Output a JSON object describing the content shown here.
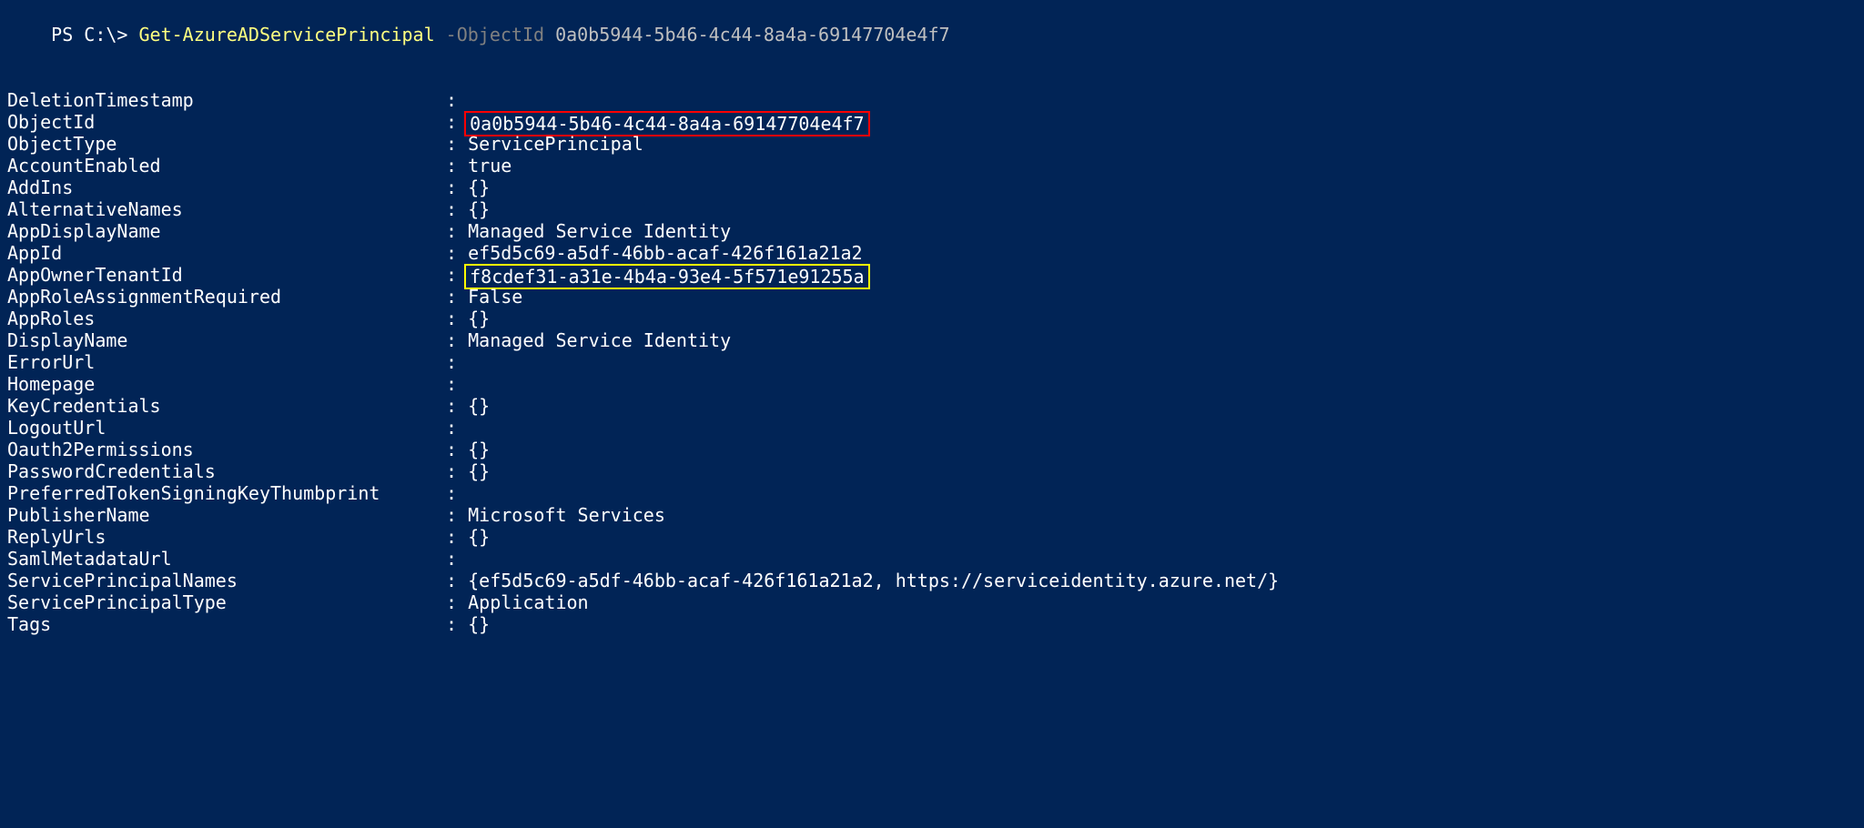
{
  "prompt": {
    "prefix": "PS C:\\> ",
    "cmdlet": "Get-AzureADServicePrincipal",
    "param": " -ObjectId ",
    "arg": "0a0b5944-5b46-4c44-8a4a-69147704e4f7"
  },
  "properties": [
    {
      "key": "DeletionTimestamp",
      "value": "",
      "highlight": null
    },
    {
      "key": "ObjectId",
      "value": "0a0b5944-5b46-4c44-8a4a-69147704e4f7",
      "highlight": "red"
    },
    {
      "key": "ObjectType",
      "value": "ServicePrincipal",
      "highlight": null
    },
    {
      "key": "AccountEnabled",
      "value": "true",
      "highlight": null
    },
    {
      "key": "AddIns",
      "value": "{}",
      "highlight": null
    },
    {
      "key": "AlternativeNames",
      "value": "{}",
      "highlight": null
    },
    {
      "key": "AppDisplayName",
      "value": "Managed Service Identity",
      "highlight": null
    },
    {
      "key": "AppId",
      "value": "ef5d5c69-a5df-46bb-acaf-426f161a21a2",
      "highlight": null
    },
    {
      "key": "AppOwnerTenantId",
      "value": "f8cdef31-a31e-4b4a-93e4-5f571e91255a",
      "highlight": "yellow"
    },
    {
      "key": "AppRoleAssignmentRequired",
      "value": "False",
      "highlight": null
    },
    {
      "key": "AppRoles",
      "value": "{}",
      "highlight": null
    },
    {
      "key": "DisplayName",
      "value": "Managed Service Identity",
      "highlight": null
    },
    {
      "key": "ErrorUrl",
      "value": "",
      "highlight": null
    },
    {
      "key": "Homepage",
      "value": "",
      "highlight": null
    },
    {
      "key": "KeyCredentials",
      "value": "{}",
      "highlight": null
    },
    {
      "key": "LogoutUrl",
      "value": "",
      "highlight": null
    },
    {
      "key": "Oauth2Permissions",
      "value": "{}",
      "highlight": null
    },
    {
      "key": "PasswordCredentials",
      "value": "{}",
      "highlight": null
    },
    {
      "key": "PreferredTokenSigningKeyThumbprint",
      "value": "",
      "highlight": null
    },
    {
      "key": "PublisherName",
      "value": "Microsoft Services",
      "highlight": null
    },
    {
      "key": "ReplyUrls",
      "value": "{}",
      "highlight": null
    },
    {
      "key": "SamlMetadataUrl",
      "value": "",
      "highlight": null
    },
    {
      "key": "ServicePrincipalNames",
      "value": "{ef5d5c69-a5df-46bb-acaf-426f161a21a2, https://serviceidentity.azure.net/}",
      "highlight": null
    },
    {
      "key": "ServicePrincipalType",
      "value": "Application",
      "highlight": null
    },
    {
      "key": "Tags",
      "value": "{}",
      "highlight": null
    }
  ],
  "sep": " : "
}
